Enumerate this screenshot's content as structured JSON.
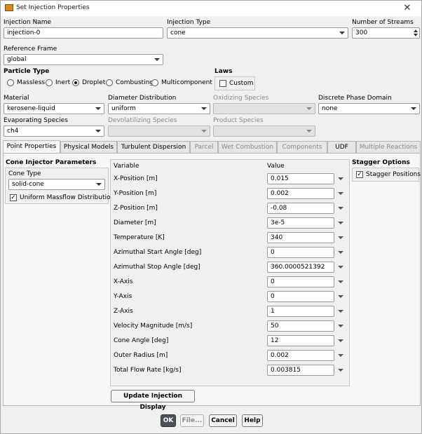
{
  "window": {
    "title": "Set Injection Properties",
    "close_glyph": "✕"
  },
  "injection_name": {
    "label": "Injection Name",
    "value": "injection-0"
  },
  "injection_type": {
    "label": "Injection Type",
    "value": "cone"
  },
  "number_of_streams": {
    "label": "Number of Streams",
    "value": "300"
  },
  "reference_frame": {
    "label": "Reference Frame",
    "value": "global"
  },
  "particle_type": {
    "label": "Particle Type",
    "options": [
      "Massless",
      "Inert",
      "Droplet",
      "Combusting",
      "Multicomponent"
    ],
    "selected": "Droplet"
  },
  "laws": {
    "label": "Laws",
    "custom_label": "Custom",
    "custom_checked": false
  },
  "material": {
    "label": "Material",
    "value": "kerosene-liquid"
  },
  "diameter_distribution": {
    "label": "Diameter Distribution",
    "value": "uniform"
  },
  "oxidizing_species": {
    "label": "Oxidizing Species",
    "value": ""
  },
  "discrete_phase_domain": {
    "label": "Discrete Phase Domain",
    "value": "none"
  },
  "evaporating_species": {
    "label": "Evaporating Species",
    "value": "ch4"
  },
  "devolatilizing_species": {
    "label": "Devolatilizing Species",
    "value": ""
  },
  "product_species": {
    "label": "Product Species",
    "value": ""
  },
  "tabs": [
    {
      "label": "Point Properties",
      "active": true,
      "enabled": true
    },
    {
      "label": "Physical Models",
      "active": false,
      "enabled": true
    },
    {
      "label": "Turbulent Dispersion",
      "active": false,
      "enabled": true
    },
    {
      "label": "Parcel",
      "active": false,
      "enabled": false
    },
    {
      "label": "Wet Combustion",
      "active": false,
      "enabled": false
    },
    {
      "label": "Components",
      "active": false,
      "enabled": false
    },
    {
      "label": "UDF",
      "active": false,
      "enabled": true
    },
    {
      "label": "Multiple Reactions",
      "active": false,
      "enabled": false
    }
  ],
  "cone_injector": {
    "title": "Cone Injector Parameters",
    "cone_type_label": "Cone Type",
    "cone_type_value": "solid-cone",
    "uniform_massflow_label": "Uniform Massflow Distribution",
    "uniform_massflow_checked": true
  },
  "table": {
    "variable_header": "Variable",
    "value_header": "Value",
    "rows": [
      {
        "variable": "X-Position [m]",
        "value": "0.015"
      },
      {
        "variable": "Y-Position [m]",
        "value": "0.002"
      },
      {
        "variable": "Z-Position [m]",
        "value": "-0.08"
      },
      {
        "variable": "Diameter [m]",
        "value": "3e-5"
      },
      {
        "variable": "Temperature [K]",
        "value": "340"
      },
      {
        "variable": "Azimuthal Start Angle [deg]",
        "value": "0"
      },
      {
        "variable": "Azimuthal Stop Angle [deg]",
        "value": "360.0000521392"
      },
      {
        "variable": "X-Axis",
        "value": "0"
      },
      {
        "variable": "Y-Axis",
        "value": "0"
      },
      {
        "variable": "Z-Axis",
        "value": "1"
      },
      {
        "variable": "Velocity Magnitude [m/s]",
        "value": "50"
      },
      {
        "variable": "Cone Angle [deg]",
        "value": "12"
      },
      {
        "variable": "Outer Radius [m]",
        "value": "0.002"
      },
      {
        "variable": "Total Flow Rate [kg/s]",
        "value": "0.003815"
      }
    ]
  },
  "stagger": {
    "title": "Stagger Options",
    "positions_label": "Stagger Positions",
    "positions_checked": true
  },
  "update_button": "Update Injection Display",
  "buttons": {
    "ok": "OK",
    "file": "File...",
    "cancel": "Cancel",
    "help": "Help"
  },
  "check_glyph": "✓",
  "colors": {
    "primary_button": "#4a4f58",
    "app_icon": "#d98a1c"
  }
}
